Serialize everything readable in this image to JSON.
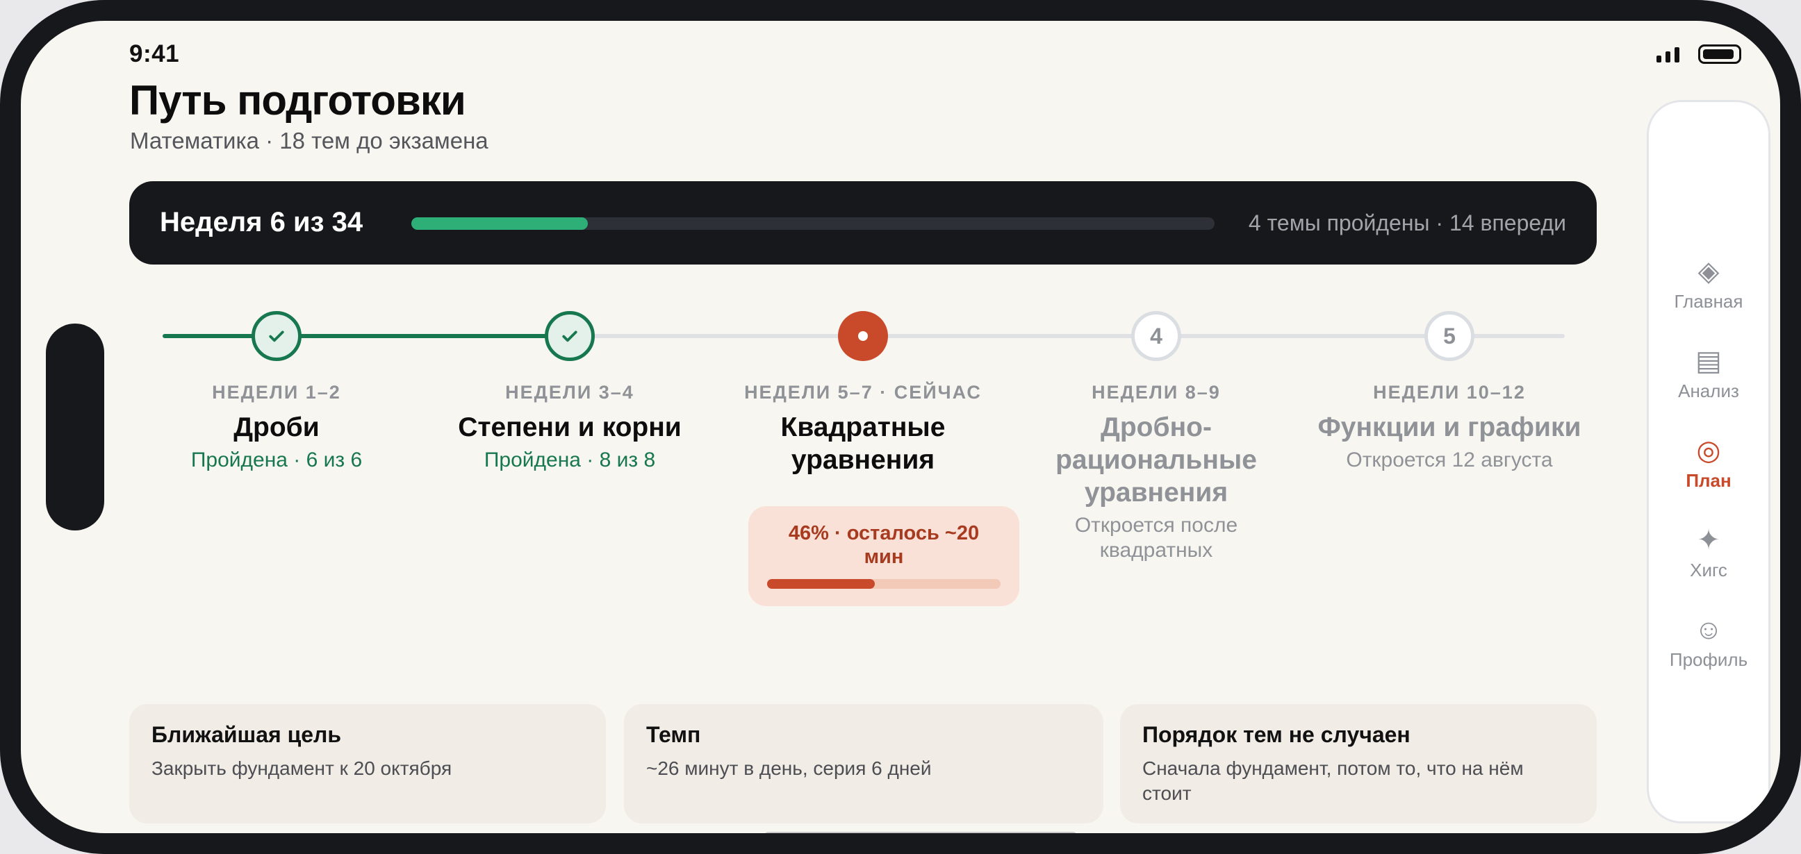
{
  "status_bar": {
    "time": "9:41"
  },
  "header": {
    "title": "Путь подготовки",
    "subtitle": "Математика · 18 тем до экзамена"
  },
  "week_bar": {
    "label": "Неделя 6 из 34",
    "progress": 0.22,
    "stats": "4 темы пройдены · 14 впереди",
    "accent": "#2eaf78"
  },
  "timeline": {
    "steps": [
      {
        "state": "done",
        "weeks": "НЕДЕЛИ 1–2",
        "title": "Дроби",
        "status": "Пройдена · 6 из 6"
      },
      {
        "state": "done",
        "weeks": "НЕДЕЛИ 3–4",
        "title": "Степени и корни",
        "status": "Пройдена · 8 из 8"
      },
      {
        "state": "current",
        "weeks": "НЕДЕЛИ 5–7 · СЕЙЧАС",
        "title": "Квадратные уравнения",
        "progress_text": "46% · осталось ~20 мин",
        "progress": 0.46
      },
      {
        "state": "locked",
        "number": "4",
        "weeks": "НЕДЕЛИ 8–9",
        "title": "Дробно-рациональные уравнения",
        "status": "Откроется после квадратных"
      },
      {
        "state": "locked",
        "number": "5",
        "weeks": "НЕДЕЛИ 10–12",
        "title": "Функции и графики",
        "status": "Откроется 12 августа"
      }
    ]
  },
  "cards": [
    {
      "title": "Ближайшая цель",
      "text": "Закрыть фундамент к 20 октября"
    },
    {
      "title": "Темп",
      "text": "~26 минут в день, серия 6 дней"
    },
    {
      "title": "Порядок тем не случаен",
      "text": "Сначала фундамент, потом то, что на нём стоит"
    }
  ],
  "nav": {
    "items": [
      {
        "icon": "◈",
        "icon_name": "diamond-icon",
        "label": "Главная"
      },
      {
        "icon": "▤",
        "icon_name": "list-icon",
        "label": "Анализ"
      },
      {
        "icon": "◎",
        "icon_name": "target-icon",
        "label": "План",
        "active": true
      },
      {
        "icon": "✦",
        "icon_name": "sparkle-icon",
        "label": "Хигс"
      },
      {
        "icon": "☺",
        "icon_name": "profile-icon",
        "label": "Профиль"
      }
    ]
  },
  "colors": {
    "done": "#17774e",
    "current": "#c94a2a",
    "dark": "#17181b"
  }
}
